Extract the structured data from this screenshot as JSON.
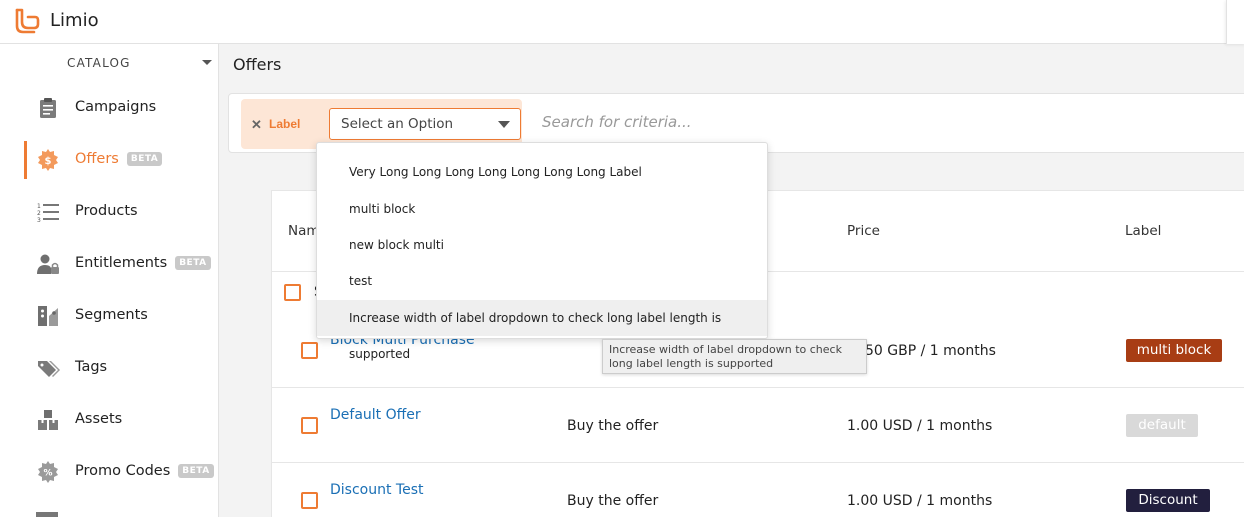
{
  "app": {
    "brand": "Limio",
    "accent": "#ee7b33"
  },
  "sidebar": {
    "section_label": "CATALOG",
    "items": [
      {
        "label": "Campaigns",
        "icon": "clipboard-icon",
        "beta": ""
      },
      {
        "label": "Offers",
        "icon": "dollar-gear-icon",
        "beta": "BETA",
        "active": true
      },
      {
        "label": "Products",
        "icon": "numbered-list-icon",
        "beta": ""
      },
      {
        "label": "Entitlements",
        "icon": "user-lock-icon",
        "beta": "BETA"
      },
      {
        "label": "Segments",
        "icon": "segments-icon",
        "beta": ""
      },
      {
        "label": "Tags",
        "icon": "tags-icon",
        "beta": ""
      },
      {
        "label": "Assets",
        "icon": "boxes-icon",
        "beta": ""
      },
      {
        "label": "Promo Codes",
        "icon": "percent-gear-icon",
        "beta": "BETA"
      }
    ]
  },
  "main": {
    "title": "Offers"
  },
  "filter": {
    "chip_label": "Label",
    "select_value": "Select an Option",
    "search_placeholder": "Search for criteria..."
  },
  "dropdown": {
    "options": [
      "Very Long Long Long Long Long Long Long Label",
      "multi block",
      "new block multi",
      "test",
      "Increase width of label dropdown to check long label length is supported"
    ],
    "hovered_index": 4,
    "tooltip": "Increase width of label dropdown to check long label length is supported"
  },
  "table": {
    "headers": {
      "name": "Nam",
      "price": "Price",
      "label": "Label"
    },
    "select_all_partial": "S",
    "rows": [
      {
        "name": "Block Multi Purchase",
        "description": "",
        "price": "50 GBP / 1 months",
        "label": "multi block",
        "label_color": "#a83d14"
      },
      {
        "name": "Default Offer",
        "description": "Buy the offer",
        "price": "1.00 USD / 1 months",
        "label": "default",
        "label_color": "#d9d9d9"
      },
      {
        "name": "Discount Test",
        "description": "Buy the offer",
        "price": "1.00 USD / 1 months",
        "label": "Discount",
        "label_color": "#221f3e"
      }
    ]
  }
}
